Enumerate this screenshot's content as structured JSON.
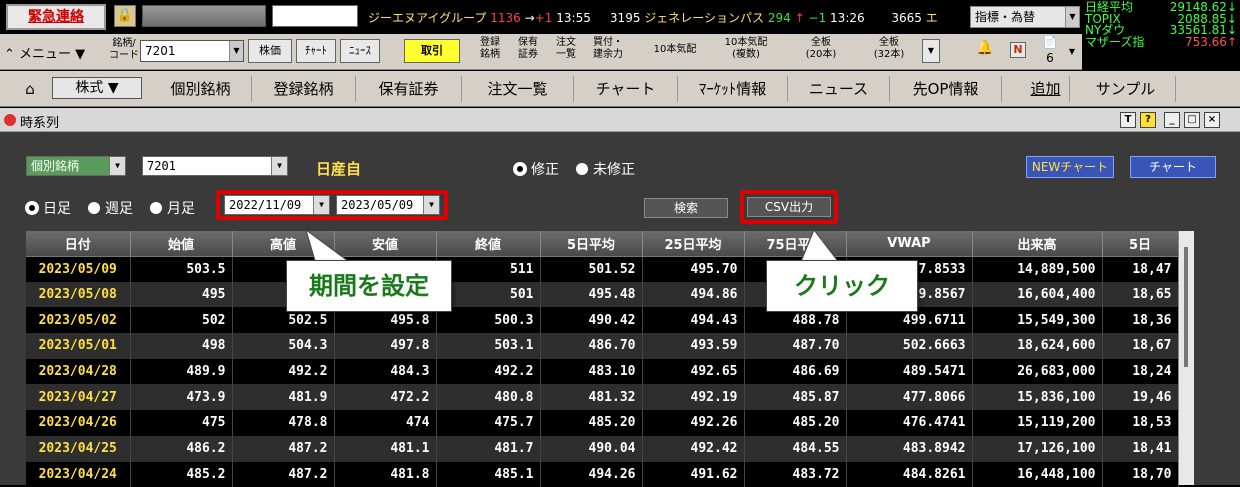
{
  "ticker": {
    "emergency": "緊急連絡",
    "lock_icon": "lock-icon",
    "items": [
      {
        "name": "ジーエヌアイグループ",
        "code": "",
        "price": "1136",
        "arrow": "→",
        "change": "+1",
        "time": "13:55"
      },
      {
        "name": "ジェネレーションパス",
        "code": "3195",
        "price": "294",
        "arrow": "↑",
        "change": "−1",
        "time": "13:26"
      },
      {
        "name": "エ",
        "code": "3665",
        "price": "",
        "arrow": "",
        "change": "",
        "time": ""
      }
    ],
    "market_select": "指標・為替",
    "indices": [
      {
        "name": "日経平均",
        "value": "29148.62↓",
        "down": false
      },
      {
        "name": "TOPIX",
        "value": "2088.85↓",
        "down": false
      },
      {
        "name": "NYダウ",
        "value": "33561.81↓",
        "down": false
      },
      {
        "name": "マザーズ指",
        "value": "753.66↑",
        "down": true
      }
    ]
  },
  "toolbar": {
    "menu": "メニュー",
    "code_label": "銘柄/\nコード",
    "code_value": "7201",
    "kabuka": "株価",
    "chart": "ﾁｬｰﾄ",
    "news": "ﾆｭｰｽ",
    "torihiki": "取引",
    "touroku": "登録\n銘柄",
    "hoyuu": "保有\n証券",
    "chuumon": "注文\n一覧",
    "kaitsuke": "買付・\n建余力",
    "kehai10": "10本気配",
    "kehai10_multi": "10本気配\n(複数)",
    "zenita20": "全板\n(20本)",
    "zenita32": "全板\n(32本)",
    "n_btn": "N",
    "count": "6"
  },
  "navbar": {
    "home_icon": "home-icon",
    "items": [
      "株式",
      "個別銘柄",
      "登録銘柄",
      "保有証券",
      "注文一覧",
      "チャート",
      "ﾏｰｹｯﾄ情報",
      "ニュース",
      "先OP情報",
      "追加",
      "サンプル"
    ]
  },
  "window": {
    "title": "時系列",
    "controls": [
      "T",
      "?",
      "_",
      "□",
      "×"
    ]
  },
  "form": {
    "mode_select": "個別銘柄",
    "code_select": "7201",
    "company": "日産自",
    "adjust_options": [
      "修正",
      "未修正"
    ],
    "adjust_selected": "修正",
    "period_options": [
      "日足",
      "週足",
      "月足"
    ],
    "period_selected": "日足",
    "date_from": "2022/11/09",
    "date_to": "2023/05/09",
    "search": "検索",
    "csv": "CSV出力",
    "new_chart": "NEWチャート",
    "chart": "チャート"
  },
  "annotations": {
    "period": "期間を設定",
    "click": "クリック"
  },
  "table": {
    "headers": [
      "日付",
      "始値",
      "高値",
      "安値",
      "終値",
      "5日平均",
      "25日平均",
      "75日平均",
      "VWAP",
      "出来高",
      "5日"
    ],
    "rows": [
      [
        "2023/05/09",
        "503.5",
        "",
        "",
        "511",
        "501.52",
        "495.70",
        "",
        "7.8533",
        "14,889,500",
        "18,47"
      ],
      [
        "2023/05/08",
        "495",
        "",
        "",
        "501",
        "495.48",
        "494.86",
        "",
        "9.8567",
        "16,604,400",
        "18,65"
      ],
      [
        "2023/05/02",
        "502",
        "502.5",
        "495.8",
        "500.3",
        "490.42",
        "494.43",
        "488.78",
        "499.6711",
        "15,549,300",
        "18,36"
      ],
      [
        "2023/05/01",
        "498",
        "504.3",
        "497.8",
        "503.1",
        "486.70",
        "493.59",
        "487.70",
        "502.6663",
        "18,624,600",
        "18,67"
      ],
      [
        "2023/04/28",
        "489.9",
        "492.2",
        "484.3",
        "492.2",
        "483.10",
        "492.65",
        "486.69",
        "489.5471",
        "26,683,000",
        "18,24"
      ],
      [
        "2023/04/27",
        "473.9",
        "481.9",
        "472.2",
        "480.8",
        "481.32",
        "492.19",
        "485.87",
        "477.8066",
        "15,836,100",
        "19,46"
      ],
      [
        "2023/04/26",
        "475",
        "478.8",
        "474",
        "475.7",
        "485.20",
        "492.26",
        "485.20",
        "476.4741",
        "15,119,200",
        "18,53"
      ],
      [
        "2023/04/25",
        "486.2",
        "487.2",
        "481.1",
        "481.7",
        "490.04",
        "492.42",
        "484.55",
        "483.8942",
        "17,126,100",
        "18,41"
      ],
      [
        "2023/04/24",
        "485.2",
        "487.2",
        "481.8",
        "485.1",
        "494.26",
        "491.62",
        "483.72",
        "484.8261",
        "16,448,100",
        "18,70"
      ]
    ]
  }
}
